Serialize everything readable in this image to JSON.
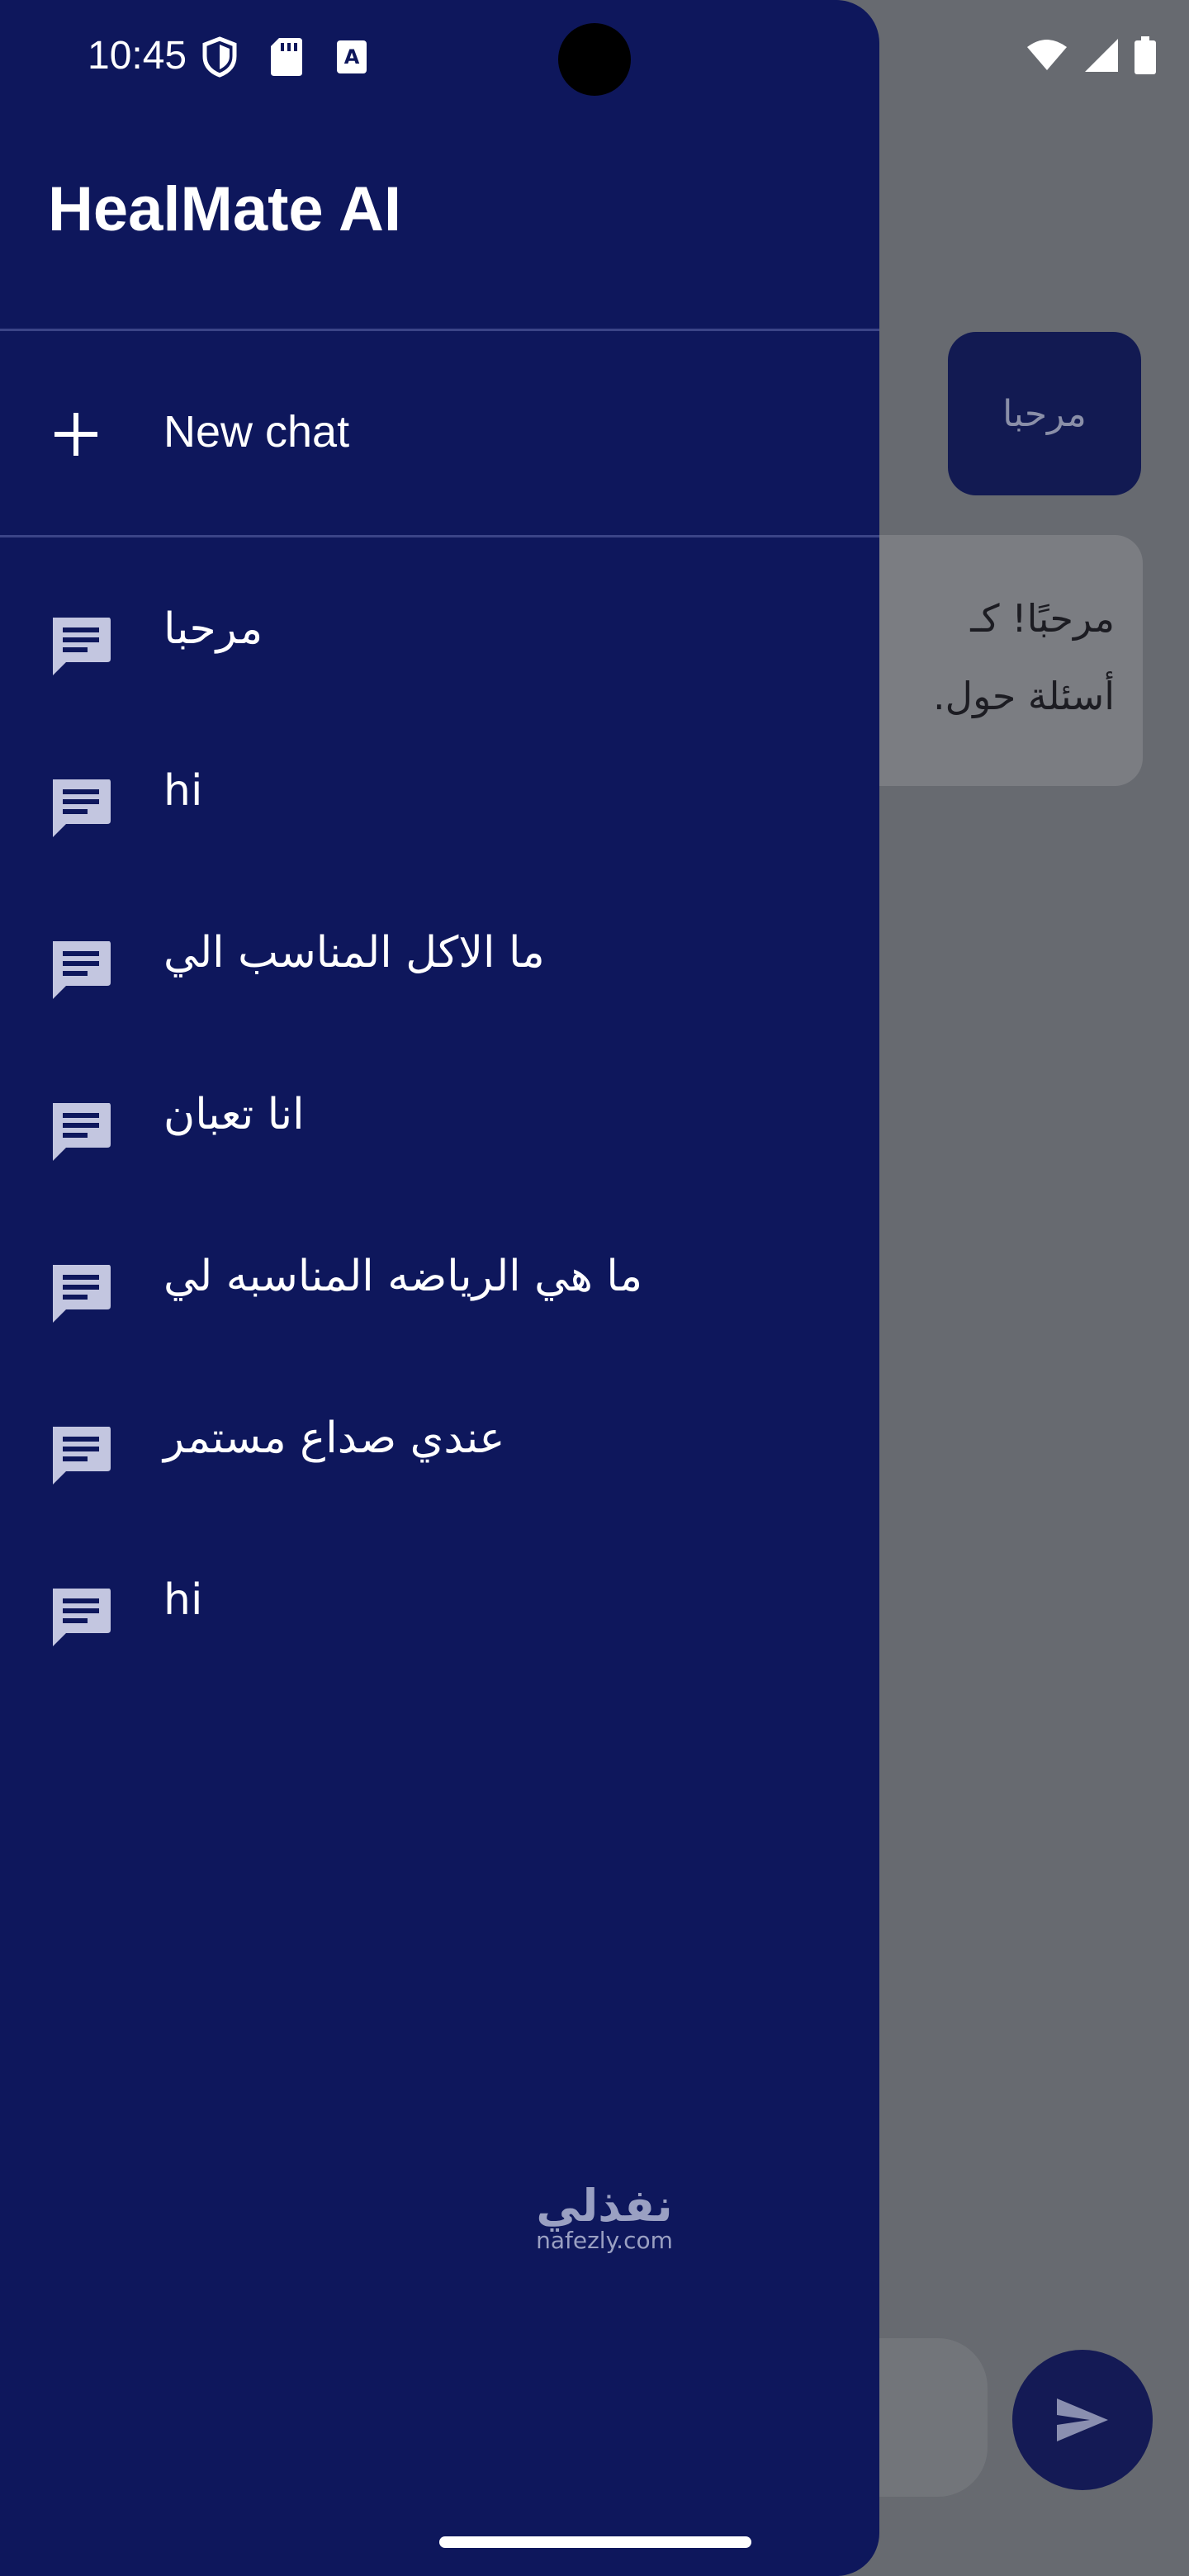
{
  "status_bar": {
    "time": "10:45"
  },
  "drawer": {
    "title": "HealMate AI",
    "new_chat_label": "New chat",
    "history": [
      {
        "label": "مرحبا"
      },
      {
        "label": "hi"
      },
      {
        "label": "ما الاكل المناسب الي"
      },
      {
        "label": "انا تعبان"
      },
      {
        "label": "ما هي الرياضه المناسبه لي"
      },
      {
        "label": "عندي صداع مستمر"
      },
      {
        "label": "hi"
      }
    ]
  },
  "background_chat": {
    "user_message": "مرحبا",
    "bot_message_line1": "مرحبًا! كـ",
    "bot_message_line2": "أسئلة حول."
  },
  "watermark": {
    "arabic": "نفذلي",
    "latin": "nafezly.com"
  },
  "colors": {
    "drawer_bg": "#0e175c",
    "scrim_bg": "#676a70",
    "icon_tint": "#c3c6e0"
  }
}
